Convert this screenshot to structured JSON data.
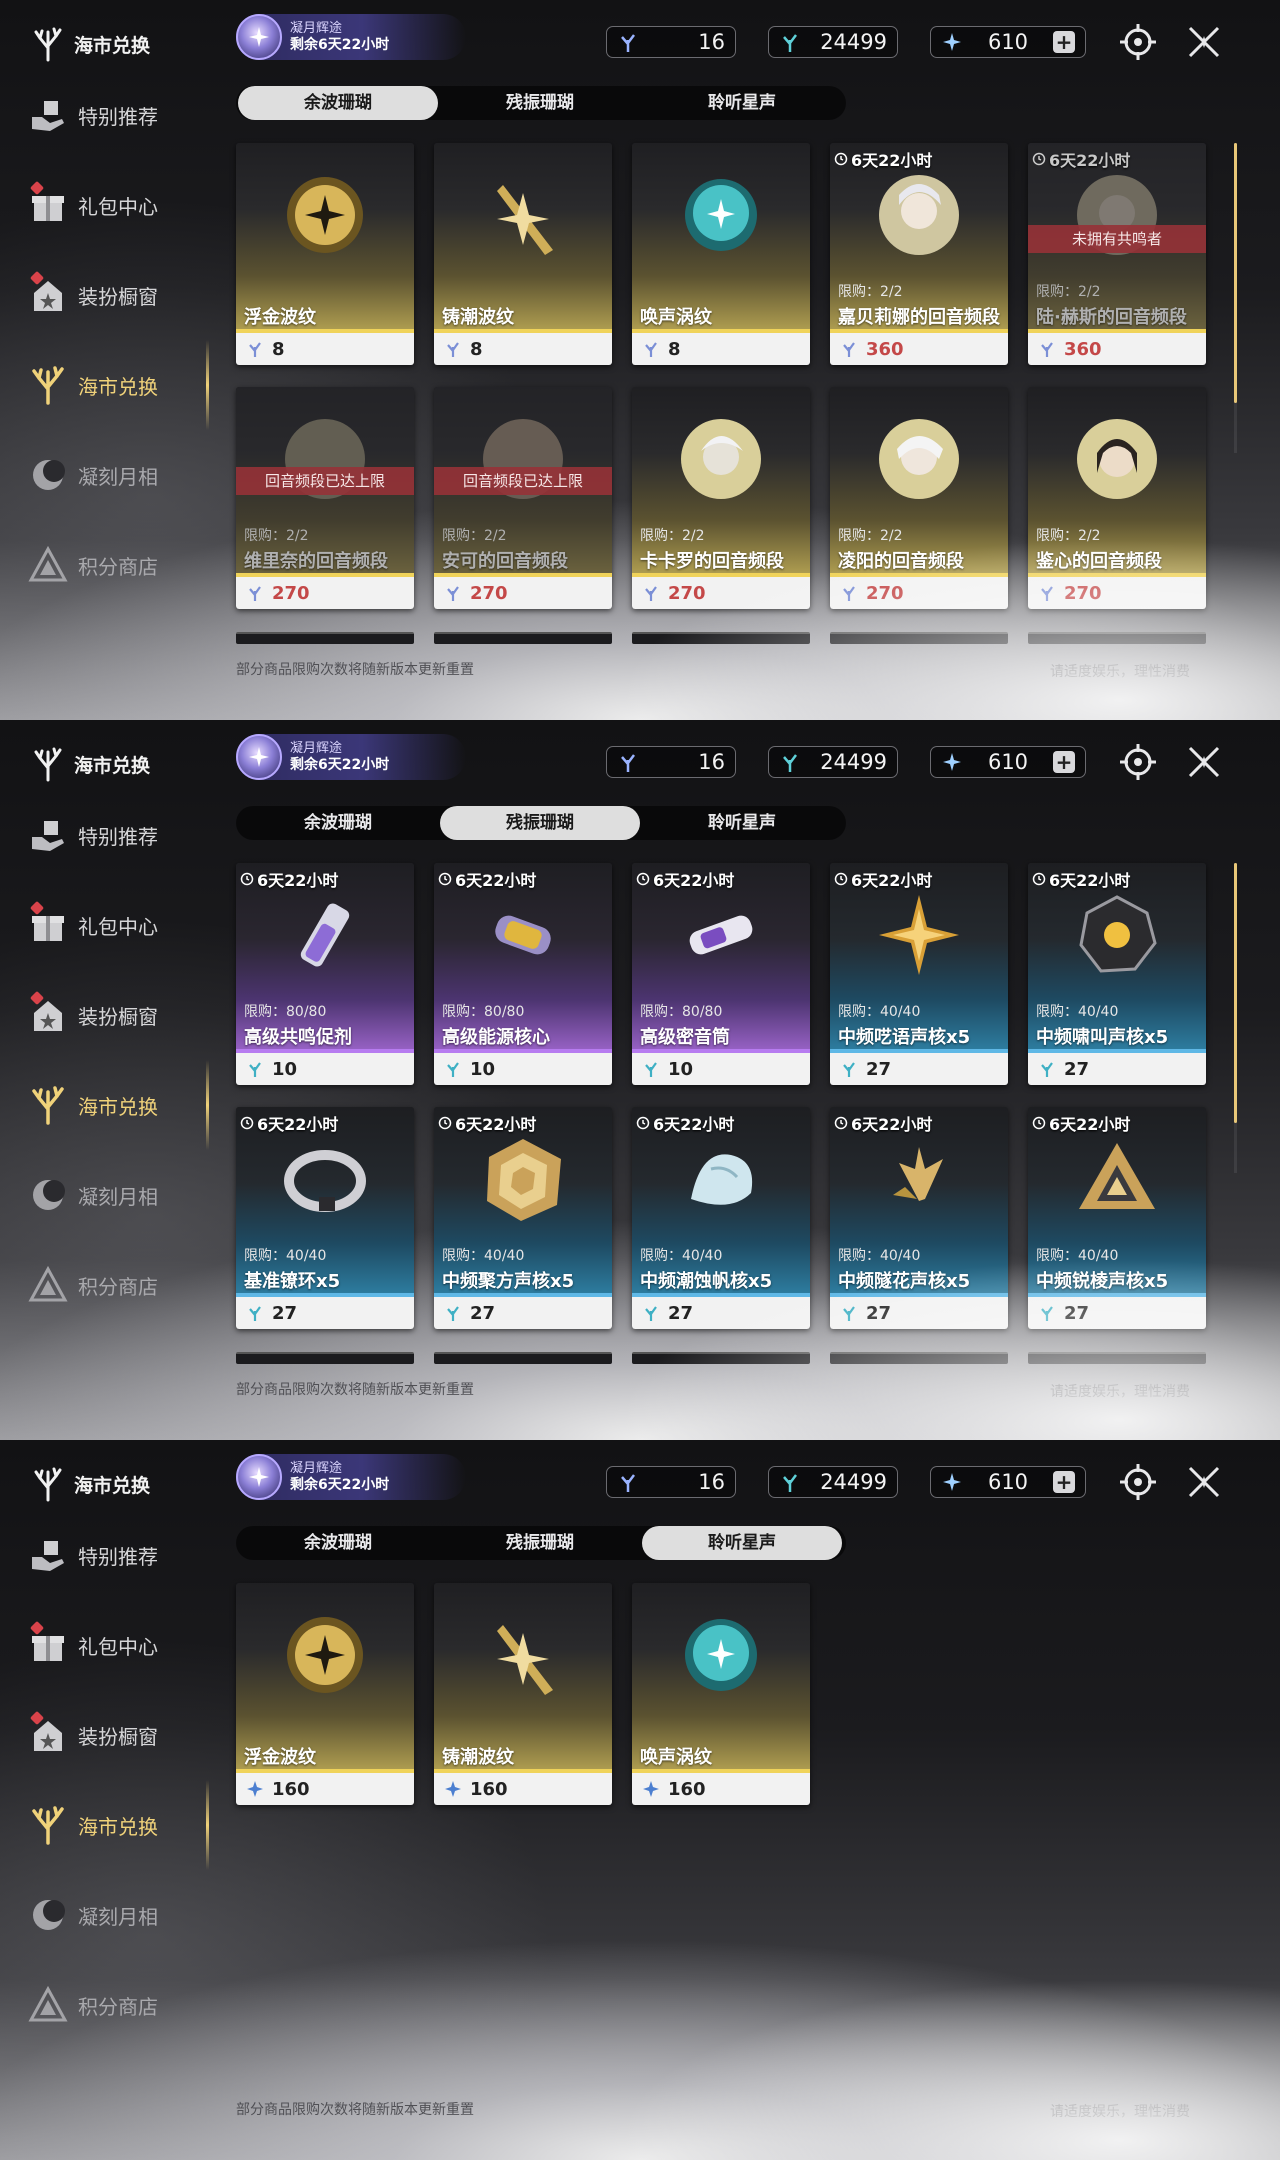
{
  "sidebar": {
    "title": "海市兑换",
    "items": [
      {
        "label": "特别推荐"
      },
      {
        "label": "礼包中心"
      },
      {
        "label": "装扮橱窗"
      },
      {
        "label": "海市兑换"
      },
      {
        "label": "凝刻月相"
      },
      {
        "label": "积分商店"
      }
    ]
  },
  "event": {
    "line1": "凝月辉途",
    "line2": "剩余6天22小时"
  },
  "currencies": {
    "a": "16",
    "b": "24499",
    "c": "610"
  },
  "tabs": [
    "余波珊瑚",
    "残振珊瑚",
    "聆听星声"
  ],
  "footer": {
    "left": "部分商品限购次数将随新版本更新重置",
    "right": "请适度娱乐，理性消费"
  },
  "panel1": {
    "row1": [
      {
        "name": "浮金波纹",
        "price": "8"
      },
      {
        "name": "铸潮波纹",
        "price": "8"
      },
      {
        "name": "唤声涡纹",
        "price": "8"
      },
      {
        "name": "嘉贝莉娜的回音频段",
        "price": "360",
        "limit": "限购：2/2",
        "timer": "6天22小时"
      },
      {
        "name": "陆·赫斯的回音频段",
        "price": "360",
        "limit": "限购：2/2",
        "timer": "6天22小时",
        "banner": "未拥有共鸣者"
      }
    ],
    "row2": [
      {
        "name": "维里奈的回音频段",
        "price": "270",
        "limit": "限购：2/2",
        "banner": "回音频段已达上限"
      },
      {
        "name": "安可的回音频段",
        "price": "270",
        "limit": "限购：2/2",
        "banner": "回音频段已达上限"
      },
      {
        "name": "卡卡罗的回音频段",
        "price": "270",
        "limit": "限购：2/2"
      },
      {
        "name": "凌阳的回音频段",
        "price": "270",
        "limit": "限购：2/2"
      },
      {
        "name": "鉴心的回音频段",
        "price": "270",
        "limit": "限购：2/2"
      }
    ]
  },
  "panel2": {
    "row1": [
      {
        "name": "高级共鸣促剂",
        "price": "10",
        "limit": "限购：80/80",
        "timer": "6天22小时"
      },
      {
        "name": "高级能源核心",
        "price": "10",
        "limit": "限购：80/80",
        "timer": "6天22小时"
      },
      {
        "name": "高级密音筒",
        "price": "10",
        "limit": "限购：80/80",
        "timer": "6天22小时"
      },
      {
        "name": "中频呓语声核x5",
        "price": "27",
        "limit": "限购：40/40",
        "timer": "6天22小时"
      },
      {
        "name": "中频啸叫声核x5",
        "price": "27",
        "limit": "限购：40/40",
        "timer": "6天22小时"
      }
    ],
    "row2": [
      {
        "name": "基准镣环x5",
        "price": "27",
        "limit": "限购：40/40",
        "timer": "6天22小时"
      },
      {
        "name": "中频聚方声核x5",
        "price": "27",
        "limit": "限购：40/40",
        "timer": "6天22小时"
      },
      {
        "name": "中频潮蚀帆核x5",
        "price": "27",
        "limit": "限购：40/40",
        "timer": "6天22小时"
      },
      {
        "name": "中频隧花声核x5",
        "price": "27",
        "limit": "限购：40/40",
        "timer": "6天22小时"
      },
      {
        "name": "中频锐棱声核x5",
        "price": "27",
        "limit": "限购：40/40",
        "timer": "6天22小时"
      }
    ]
  },
  "panel3": {
    "row1": [
      {
        "name": "浮金波纹",
        "price": "160"
      },
      {
        "name": "铸潮波纹",
        "price": "160"
      },
      {
        "name": "唤声涡纹",
        "price": "160"
      }
    ]
  }
}
